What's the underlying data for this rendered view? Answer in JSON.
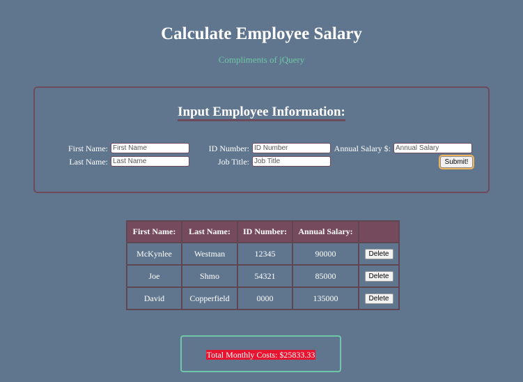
{
  "header": {
    "title": "Calculate Employee Salary",
    "subtitle": "Compliments of jQuery"
  },
  "form": {
    "heading": "Input Employee Information:",
    "first_name": {
      "label": "First Name:",
      "placeholder": "First Name",
      "value": ""
    },
    "last_name": {
      "label": "Last Name:",
      "placeholder": "Last Name",
      "value": ""
    },
    "id_number": {
      "label": "ID Number:",
      "placeholder": "ID Number",
      "value": ""
    },
    "job_title": {
      "label": "Job Title:",
      "placeholder": "Job Title",
      "value": ""
    },
    "annual_salary": {
      "label": "Annual Salary $:",
      "placeholder": "Annual Salary",
      "value": ""
    },
    "submit_label": "Submit!"
  },
  "table": {
    "headers": [
      "First Name:",
      "Last Name:",
      "ID Number:",
      "Annual Salary:",
      ""
    ],
    "rows": [
      {
        "first": "McKynlee",
        "last": "Westman",
        "id": "12345",
        "salary": "90000",
        "action": "Delete"
      },
      {
        "first": "Joe",
        "last": "Shmo",
        "id": "54321",
        "salary": "85000",
        "action": "Delete"
      },
      {
        "first": "David",
        "last": "Copperfield",
        "id": "0000",
        "salary": "135000",
        "action": "Delete"
      }
    ]
  },
  "totals": {
    "label": "Total Monthly Costs: $25833.33"
  },
  "colors": {
    "background": "#60768f",
    "accent": "#754a5c",
    "subtitle": "#6ec7a6",
    "total_highlight": "#e8132e"
  }
}
